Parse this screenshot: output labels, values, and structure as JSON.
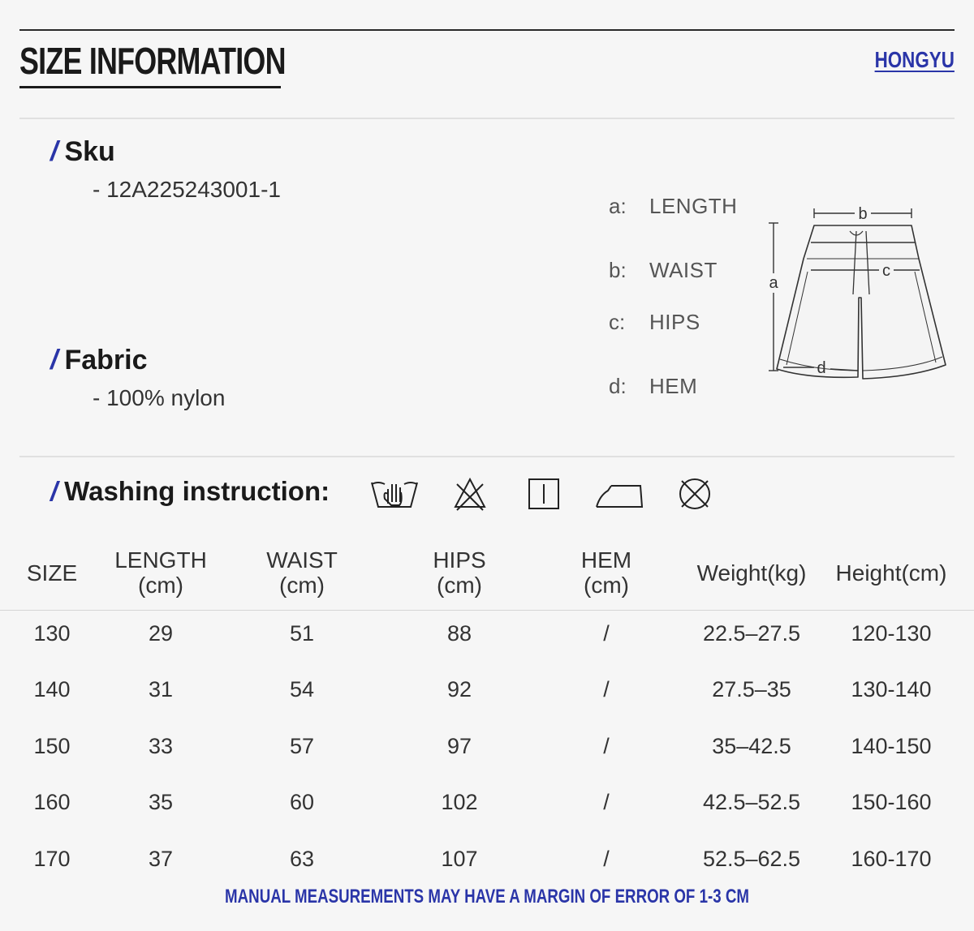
{
  "header": {
    "title": "SIZE INFORMATION",
    "brand": "HONGYU"
  },
  "sku": {
    "label": "Sku",
    "value": "- 12A225243001-1"
  },
  "fabric": {
    "label": "Fabric",
    "value": "- 100% nylon"
  },
  "slash": "/",
  "legend": [
    {
      "key": "a:",
      "value": "LENGTH"
    },
    {
      "key": "b:",
      "value": "WAIST"
    },
    {
      "key": "c:",
      "value": "HIPS"
    },
    {
      "key": "d:",
      "value": "HEM"
    }
  ],
  "diagram": {
    "labels": [
      "a",
      "b",
      "c",
      "d"
    ]
  },
  "washing": {
    "label": "Washing instruction:",
    "icons": [
      "hand-wash-icon",
      "do-not-bleach-icon",
      "line-dry-icon",
      "iron-icon",
      "do-not-tumble-dry-icon"
    ]
  },
  "table": {
    "headers": [
      {
        "line1": "SIZE",
        "line2": ""
      },
      {
        "line1": "LENGTH",
        "line2": "(cm)"
      },
      {
        "line1": "WAIST",
        "line2": "(cm)"
      },
      {
        "line1": "HIPS",
        "line2": "(cm)"
      },
      {
        "line1": "HEM",
        "line2": "(cm)"
      },
      {
        "line1": "Weight(kg)",
        "line2": ""
      },
      {
        "line1": "Height(cm)",
        "line2": ""
      }
    ],
    "rows": [
      [
        "130",
        "29",
        "51",
        "88",
        "/",
        "22.5–27.5",
        "120-130"
      ],
      [
        "140",
        "31",
        "54",
        "92",
        "/",
        "27.5–35",
        "130-140"
      ],
      [
        "150",
        "33",
        "57",
        "97",
        "/",
        "35–42.5",
        "140-150"
      ],
      [
        "160",
        "35",
        "60",
        "102",
        "/",
        "42.5–52.5",
        "150-160"
      ],
      [
        "170",
        "37",
        "63",
        "107",
        "/",
        "52.5–62.5",
        "160-170"
      ]
    ]
  },
  "footer": {
    "note": "MANUAL MEASUREMENTS MAY HAVE A MARGIN OF ERROR OF 1-3 CM"
  },
  "colors": {
    "accent": "#2a35a8",
    "text": "#222222",
    "background": "#f6f6f6"
  }
}
